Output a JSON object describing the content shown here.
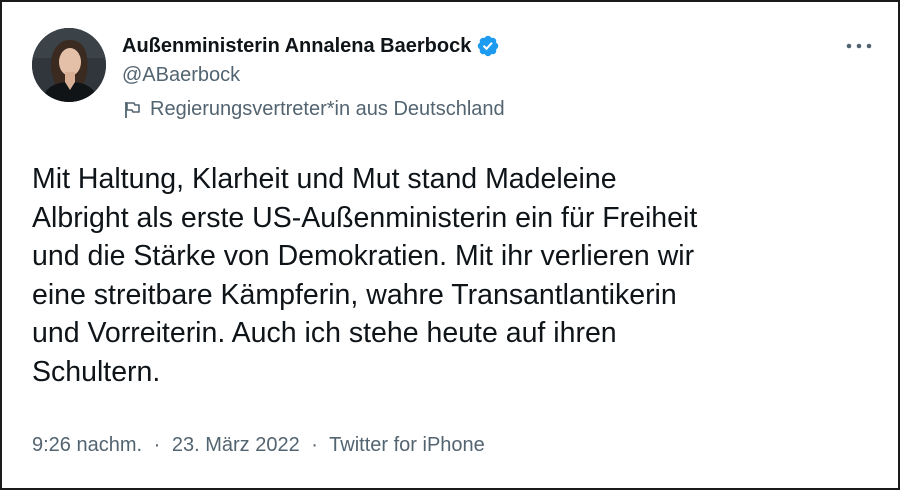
{
  "author": {
    "display_name": "Außenministerin Annalena Baerbock",
    "handle": "@ABaerbock",
    "label": "Regierungsvertreter*in aus Deutschland",
    "verified": true,
    "avatar_icon": "profile-photo"
  },
  "tweet": {
    "text": "Mit Haltung, Klarheit und Mut stand Madeleine\nAlbright als erste US-Außenministerin ein für Freiheit\nund die Stärke von Demokratien. Mit ihr verlieren wir\neine streitbare Kämpferin, wahre Transantlantikerin\nund Vorreiterin. Auch ich stehe heute auf ihren\nSchultern."
  },
  "meta": {
    "time": "9:26 nachm.",
    "separator": "·",
    "date": "23. März 2022",
    "source": "Twitter for iPhone"
  },
  "icons": {
    "verified": "verified-badge-icon",
    "flag": "flag-icon",
    "more": "more-options-icon"
  },
  "colors": {
    "text_primary": "#0f1419",
    "text_secondary": "#536471",
    "verified_blue": "#1d9bf0"
  }
}
